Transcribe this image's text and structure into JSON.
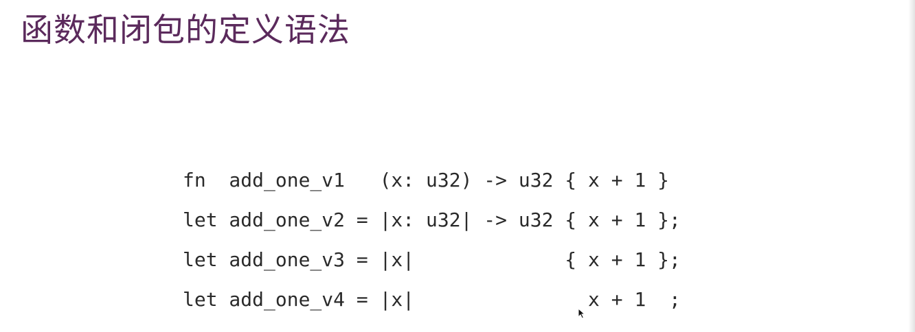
{
  "slide": {
    "title": "函数和闭包的定义语法"
  },
  "code": {
    "lines": [
      "fn  add_one_v1   (x: u32) -> u32 { x + 1 }",
      "let add_one_v2 = |x: u32| -> u32 { x + 1 };",
      "let add_one_v3 = |x|             { x + 1 };",
      "let add_one_v4 = |x|               x + 1  ;"
    ]
  },
  "cursor": {
    "icon": "mouse-pointer-icon"
  },
  "colors": {
    "title": "#5b2a5c",
    "code": "#2a2a2a",
    "background": "#ffffff"
  }
}
